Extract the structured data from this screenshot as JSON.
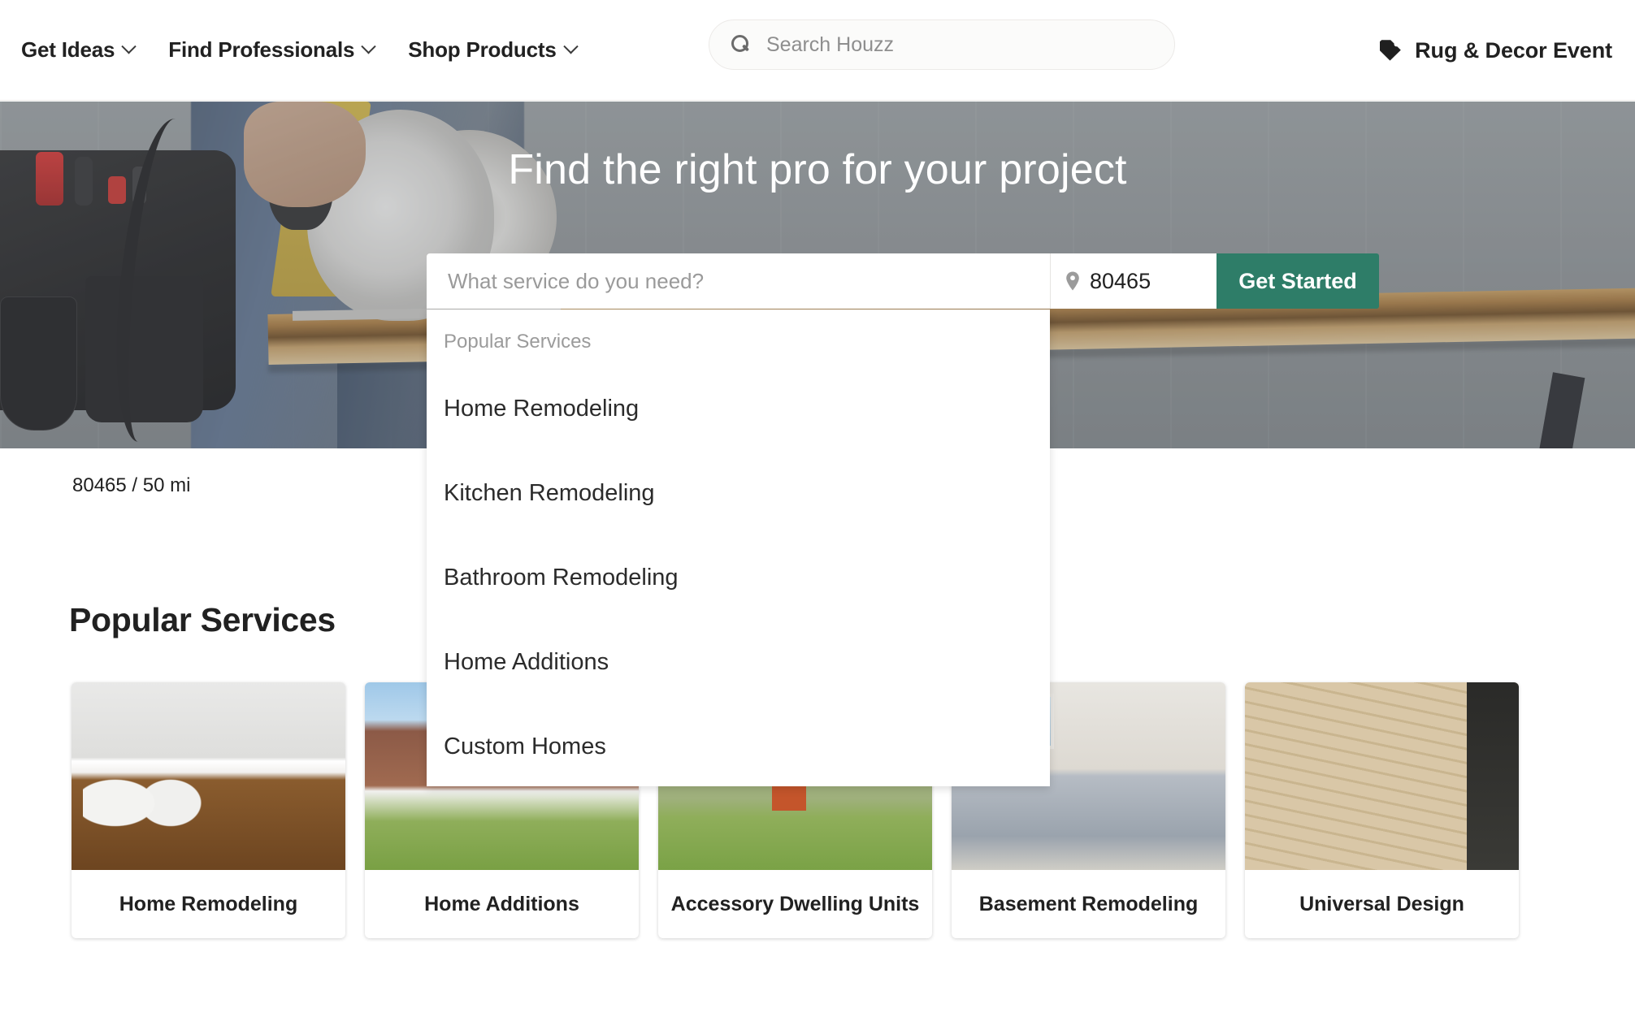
{
  "header": {
    "nav": [
      {
        "label": "Get Ideas",
        "icon": "chevron-down-icon"
      },
      {
        "label": "Find Professionals",
        "icon": "chevron-down-icon"
      },
      {
        "label": "Shop Products",
        "icon": "chevron-down-icon"
      }
    ],
    "search": {
      "placeholder": "Search Houzz",
      "value": "",
      "icon": "search-icon"
    },
    "promo": {
      "label": "Rug & Decor Event",
      "icon": "tag-icon"
    }
  },
  "hero": {
    "title": "Find the right pro for your project",
    "service_input": {
      "placeholder": "What service do you need?",
      "value": ""
    },
    "zip_input": {
      "value": "80465",
      "icon": "map-pin-icon"
    },
    "cta": "Get Started"
  },
  "dropdown": {
    "heading": "Popular Services",
    "items": [
      "Home Remodeling",
      "Kitchen Remodeling",
      "Bathroom Remodeling",
      "Home Additions",
      "Custom Homes"
    ]
  },
  "body": {
    "location_summary": "80465 / 50 mi",
    "section_title": "Popular Services",
    "cards": [
      {
        "label": "Home Remodeling",
        "img": "img-kitchen"
      },
      {
        "label": "Home Additions",
        "img": "img-house"
      },
      {
        "label": "Accessory Dwelling Units",
        "img": "img-adu"
      },
      {
        "label": "Basement Remodeling",
        "img": "img-basement"
      },
      {
        "label": "Universal Design",
        "img": "img-deck"
      }
    ]
  },
  "colors": {
    "cta_green": "#2e7d68",
    "text_dark": "#212121",
    "placeholder_gray": "#9a9a9a"
  }
}
